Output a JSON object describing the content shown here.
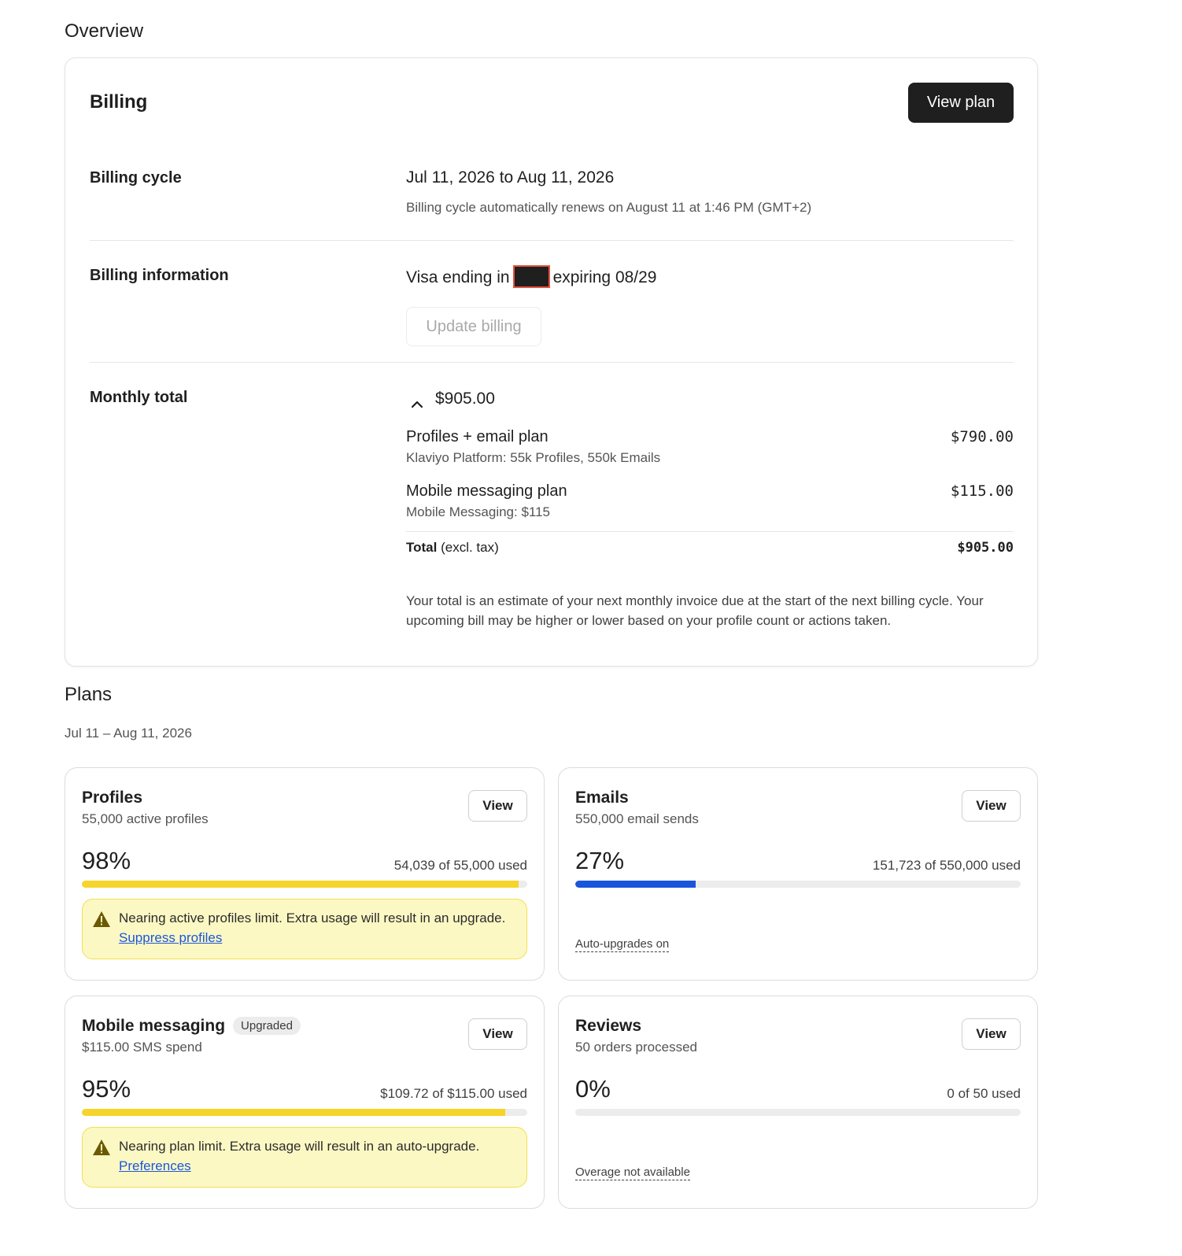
{
  "overview": {
    "title": "Overview"
  },
  "billing": {
    "title": "Billing",
    "view_plan_label": "View plan",
    "cycle": {
      "label": "Billing cycle",
      "range": "Jul 11, 2026 to Aug 11, 2026",
      "renew_note": "Billing cycle automatically renews on August 11 at 1:46 PM (GMT+2)"
    },
    "information": {
      "label": "Billing information",
      "card_prefix": "Visa ending in",
      "card_suffix": "expiring 08/29",
      "update_label": "Update billing"
    },
    "monthly": {
      "label": "Monthly total",
      "amount": "$905.00",
      "items": [
        {
          "title": "Profiles + email plan",
          "subtitle": "Klaviyo Platform: 55k Profiles, 550k Emails",
          "price": "$790.00"
        },
        {
          "title": "Mobile messaging plan",
          "subtitle": "Mobile Messaging: $115",
          "price": "$115.00"
        }
      ],
      "total_label": "Total",
      "total_suffix": "(excl. tax)",
      "total_price": "$905.00",
      "note": "Your total is an estimate of your next monthly invoice due at the start of the next billing cycle. Your upcoming bill may be higher or lower based on your profile count or actions taken."
    }
  },
  "plans": {
    "title": "Plans",
    "range": "Jul 11 – Aug 11, 2026",
    "cards": [
      {
        "name": "Profiles",
        "description": "55,000 active profiles",
        "view_label": "View",
        "percent": "98%",
        "usage_fraction": 0.98,
        "used": "54,039 of 55,000 used",
        "bar_color": "#f6d42a",
        "warning_text": "Nearing active profiles limit. Extra usage will result in an upgrade.",
        "warning_link": "Suppress profiles"
      },
      {
        "name": "Emails",
        "description": "550,000 email sends",
        "view_label": "View",
        "percent": "27%",
        "usage_fraction": 0.27,
        "used": "151,723 of 550,000 used",
        "bar_color": "#1a56db",
        "footnote": "Auto-upgrades on"
      },
      {
        "name": "Mobile messaging",
        "badge": "Upgraded",
        "description": "$115.00 SMS spend",
        "view_label": "View",
        "percent": "95%",
        "usage_fraction": 0.95,
        "used": "$109.72 of $115.00 used",
        "bar_color": "#f6d42a",
        "warning_text": "Nearing plan limit. Extra usage will result in an auto-upgrade.",
        "warning_link": "Preferences"
      },
      {
        "name": "Reviews",
        "description": "50 orders processed",
        "view_label": "View",
        "percent": "0%",
        "usage_fraction": 0,
        "used": "0 of 50 used",
        "bar_color": "#1a56db",
        "footnote": "Overage not available"
      }
    ]
  }
}
